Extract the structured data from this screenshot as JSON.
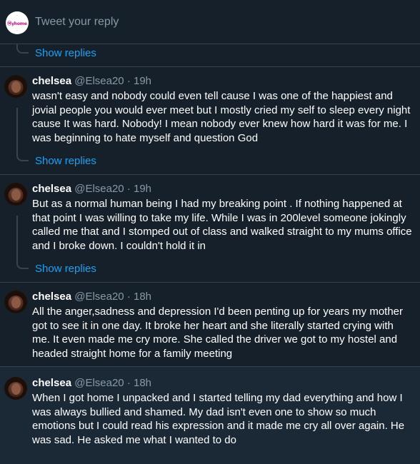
{
  "reply_bar": {
    "avatar_logo": "Ⓜyhome",
    "placeholder": "Tweet your reply"
  },
  "show_replies_label": "Show replies",
  "tweets": [
    {
      "name": "chelsea",
      "handle": "@Elsea20",
      "dot": "·",
      "time": "19h",
      "text": "wasn't easy and nobody could even tell cause I was one of the happiest and jovial people you would ever meet but I mostly cried my self to sleep every night cause It was hard. Nobody! I mean nobody ever knew how hard it was for me. I was beginning to hate myself and question God"
    },
    {
      "name": "chelsea",
      "handle": "@Elsea20",
      "dot": "·",
      "time": "19h",
      "text": "But as a normal human being I had my breaking point . If nothing happened at that point I was willing to take my life. While I was in 200level someone jokingly called me that and I stomped out of class and walked straight to my mums office and I broke down. I couldn't hold it in"
    },
    {
      "name": "chelsea",
      "handle": "@Elsea20",
      "dot": "·",
      "time": "18h",
      "text": "All the anger,sadness and depression I'd been penting up for years my mother got to see it in one day. It broke her heart and she literally started crying with me. It even made me cry more. She called the driver we got to my hostel and headed straight home for a family meeting"
    },
    {
      "name": "chelsea",
      "handle": "@Elsea20",
      "dot": "·",
      "time": "18h",
      "text": "When I got home I unpacked and I started telling my dad everything  and how I was always bullied and shamed. My dad isn't even one to show so much emotions but I could read his expression and it made me cry all over again. He was sad. He asked me what I wanted to do"
    }
  ],
  "colors": {
    "background": "#15202b",
    "highlight": "#1b2937",
    "accent": "#1da1f2",
    "muted": "#8899a6",
    "border": "#38444d"
  }
}
